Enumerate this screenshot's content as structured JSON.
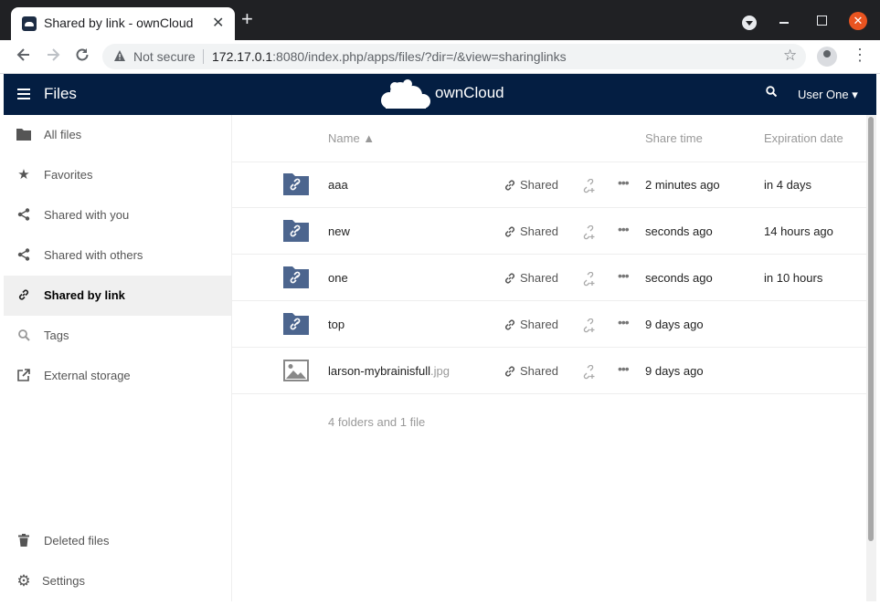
{
  "browser": {
    "tab_title": "Shared by link - ownCloud",
    "tab_close": "✕",
    "new_tab": "+",
    "close_symbol": "✕",
    "security_text": "Not secure",
    "url_host": "172.17.0.1",
    "url_rest": ":8080/index.php/apps/files/?dir=/&view=sharinglinks"
  },
  "header": {
    "app_title": "Files",
    "brand": "ownCloud",
    "user": "User One ▾",
    "bg_color": "#041e42"
  },
  "sidebar": {
    "items": [
      {
        "label": "All files",
        "icon": "folder-icon"
      },
      {
        "label": "Favorites",
        "icon": "star-icon"
      },
      {
        "label": "Shared with you",
        "icon": "share-icon"
      },
      {
        "label": "Shared with others",
        "icon": "share-icon"
      },
      {
        "label": "Shared by link",
        "icon": "link-icon",
        "active": true
      },
      {
        "label": "Tags",
        "icon": "search-icon"
      },
      {
        "label": "External storage",
        "icon": "external-link-icon"
      }
    ],
    "bottom": [
      {
        "label": "Deleted files",
        "icon": "trash-icon"
      },
      {
        "label": "Settings",
        "icon": "gear-icon"
      }
    ]
  },
  "table": {
    "columns": {
      "name": "Name ▲",
      "share_time": "Share time",
      "expiration": "Expiration date"
    },
    "rows": [
      {
        "name": "aaa",
        "ext": "",
        "type": "folder",
        "share": "Shared",
        "share_time": "2 minutes ago",
        "expiration": "in 4 days"
      },
      {
        "name": "new",
        "ext": "",
        "type": "folder",
        "share": "Shared",
        "share_time": "seconds ago",
        "expiration": "14 hours ago"
      },
      {
        "name": "one",
        "ext": "",
        "type": "folder",
        "share": "Shared",
        "share_time": "seconds ago",
        "expiration": "in 10 hours"
      },
      {
        "name": "top",
        "ext": "",
        "type": "folder",
        "share": "Shared",
        "share_time": "9 days ago",
        "expiration": ""
      },
      {
        "name": "larson-mybrainisfull",
        "ext": ".jpg",
        "type": "image",
        "share": "Shared",
        "share_time": "9 days ago",
        "expiration": ""
      }
    ],
    "more_symbol": "•••",
    "summary": "4 folders and 1 file"
  }
}
